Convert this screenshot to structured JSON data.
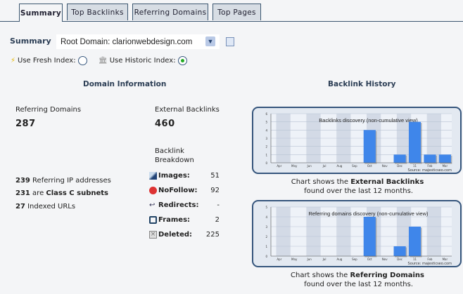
{
  "tabs": [
    {
      "label": "Summary",
      "active": true
    },
    {
      "label": "Top Backlinks"
    },
    {
      "label": "Referring Domains"
    },
    {
      "label": "Top Pages"
    }
  ],
  "summary": {
    "label": "Summary",
    "select_value": "Root Domain: clarionwebdesign.com"
  },
  "index": {
    "fresh_label": "Use Fresh Index:",
    "historic_label": "Use Historic Index:",
    "selected": "historic"
  },
  "domain_info": {
    "heading": "Domain Information",
    "referring_domains_label": "Referring Domains",
    "referring_domains": "287",
    "external_backlinks_label": "External Backlinks",
    "external_backlinks": "460",
    "stats": [
      {
        "num": "239",
        "text": " Referring IP addresses"
      },
      {
        "num": "231",
        "text": " are ",
        "bold": "Class C subnets"
      },
      {
        "num": "27",
        "text": " Indexed URLs"
      }
    ],
    "breakdown_title_1": "Backlink",
    "breakdown_title_2": "Breakdown",
    "breakdown": [
      {
        "icon": "image-icon",
        "label": "Images:",
        "value": "51"
      },
      {
        "icon": "nofollow-icon",
        "label": "NoFollow:",
        "value": "92"
      },
      {
        "icon": "redirect-icon",
        "label": "Redirects:",
        "value": "-"
      },
      {
        "icon": "frame-icon",
        "label": "Frames:",
        "value": "2"
      },
      {
        "icon": "deleted-icon",
        "label": "Deleted:",
        "value": "225"
      }
    ]
  },
  "backlink_history": {
    "heading": "Backlink History",
    "caption1": {
      "pre": "Chart shows the ",
      "bold": "External Backlinks",
      "post": " found over the last 12 months."
    },
    "caption2": {
      "pre": "Chart shows the ",
      "bold": "Referring Domains",
      "post": " found over the last 12 months."
    }
  },
  "chart_data": [
    {
      "type": "bar",
      "title": "Backlinks discovery (non-cumulative view)",
      "source": "Source: majesticseo.com",
      "categories": [
        "Apr",
        "May",
        "Jun",
        "Jul",
        "Aug",
        "Sep",
        "Oct",
        "Nov",
        "Dec",
        "11",
        "Feb",
        "Mar"
      ],
      "values": [
        0,
        0,
        0,
        0,
        0,
        0,
        4,
        0,
        1,
        5,
        1,
        1
      ],
      "ylim": [
        0,
        6
      ],
      "yticks": [
        0,
        1,
        2,
        3,
        4,
        5,
        6
      ],
      "grid": true,
      "bar_color": "#3f86ea"
    },
    {
      "type": "bar",
      "title": "Referring domains discovery (non-cumulative view)",
      "source": "Source: majesticseo.com",
      "categories": [
        "Apr",
        "May",
        "Jun",
        "Jul",
        "Aug",
        "Sep",
        "Oct",
        "Nov",
        "Dec",
        "11",
        "Feb",
        "Mar"
      ],
      "values": [
        0,
        0,
        0,
        0,
        0,
        0,
        4,
        0,
        1,
        3,
        0,
        0
      ],
      "ylim": [
        0,
        5
      ],
      "yticks": [
        0,
        1,
        2,
        3,
        4,
        5
      ],
      "grid": true,
      "bar_color": "#3f86ea"
    }
  ]
}
